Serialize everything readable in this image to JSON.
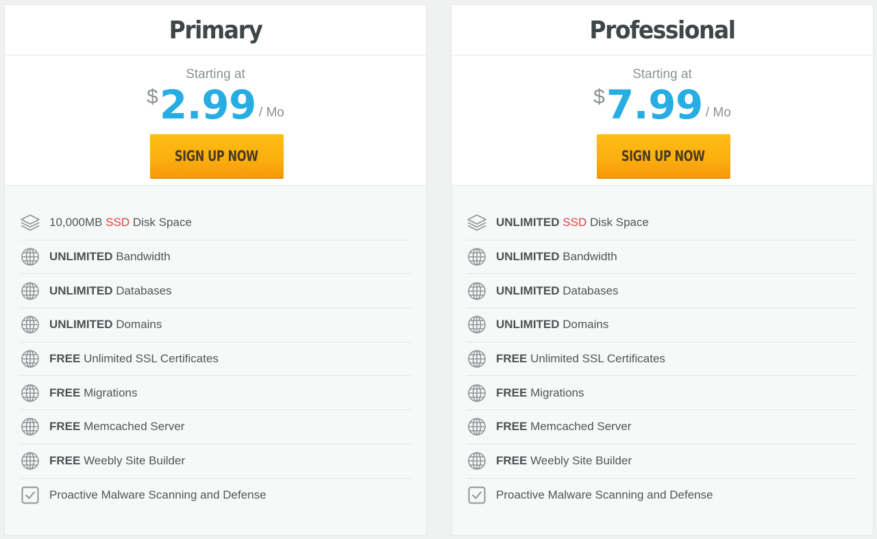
{
  "colors": {
    "accent_price": "#27ade2",
    "button": "#fcb00f",
    "ssd_highlight": "#e0403f"
  },
  "plans": [
    {
      "title": "Primary",
      "starting": "Starting at",
      "currency": "$",
      "amount": "2.99",
      "per": "/ Mo",
      "button": "SIGN UP NOW",
      "features": [
        {
          "icon": "layers-icon",
          "bold": "",
          "pre": "10,000MB ",
          "highlight": "SSD",
          "text": " Disk Space"
        },
        {
          "icon": "globe-icon",
          "bold": "UNLIMITED",
          "pre": "",
          "highlight": "",
          "text": " Bandwidth"
        },
        {
          "icon": "globe-icon",
          "bold": "UNLIMITED",
          "pre": "",
          "highlight": "",
          "text": " Databases"
        },
        {
          "icon": "globe-icon",
          "bold": "UNLIMITED",
          "pre": "",
          "highlight": "",
          "text": " Domains"
        },
        {
          "icon": "globe-icon",
          "bold": "FREE",
          "pre": "",
          "highlight": "",
          "text": " Unlimited SSL Certificates"
        },
        {
          "icon": "globe-icon",
          "bold": "FREE",
          "pre": "",
          "highlight": "",
          "text": " Migrations"
        },
        {
          "icon": "globe-icon",
          "bold": "FREE",
          "pre": "",
          "highlight": "",
          "text": " Memcached Server"
        },
        {
          "icon": "globe-icon",
          "bold": "FREE",
          "pre": "",
          "highlight": "",
          "text": " Weebly Site Builder"
        },
        {
          "icon": "checkbox-icon",
          "bold": "",
          "pre": "",
          "highlight": "",
          "text": "Proactive Malware Scanning and Defense"
        }
      ]
    },
    {
      "title": "Professional",
      "starting": "Starting at",
      "currency": "$",
      "amount": "7.99",
      "per": "/ Mo",
      "button": "SIGN UP NOW",
      "features": [
        {
          "icon": "layers-icon",
          "bold": "UNLIMITED",
          "pre": " ",
          "highlight": "SSD",
          "text": " Disk Space"
        },
        {
          "icon": "globe-icon",
          "bold": "UNLIMITED",
          "pre": "",
          "highlight": "",
          "text": " Bandwidth"
        },
        {
          "icon": "globe-icon",
          "bold": "UNLIMITED",
          "pre": "",
          "highlight": "",
          "text": " Databases"
        },
        {
          "icon": "globe-icon",
          "bold": "UNLIMITED",
          "pre": "",
          "highlight": "",
          "text": " Domains"
        },
        {
          "icon": "globe-icon",
          "bold": "FREE",
          "pre": "",
          "highlight": "",
          "text": " Unlimited SSL Certificates"
        },
        {
          "icon": "globe-icon",
          "bold": "FREE",
          "pre": "",
          "highlight": "",
          "text": " Migrations"
        },
        {
          "icon": "globe-icon",
          "bold": "FREE",
          "pre": "",
          "highlight": "",
          "text": " Memcached Server"
        },
        {
          "icon": "globe-icon",
          "bold": "FREE",
          "pre": "",
          "highlight": "",
          "text": " Weebly Site Builder"
        },
        {
          "icon": "checkbox-icon",
          "bold": "",
          "pre": "",
          "highlight": "",
          "text": "Proactive Malware Scanning and Defense"
        }
      ]
    }
  ]
}
